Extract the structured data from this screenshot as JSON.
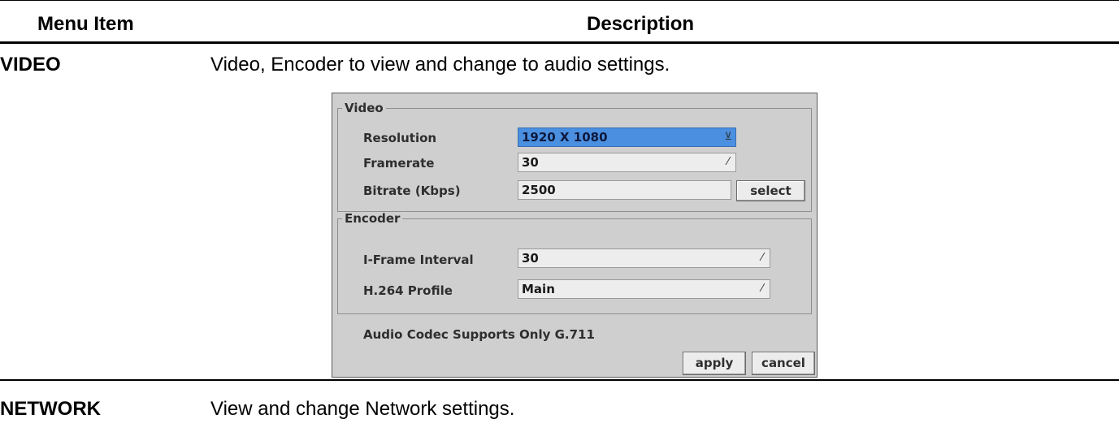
{
  "table": {
    "header_item": "Menu Item",
    "header_desc": "Description",
    "rows": [
      {
        "item": "VIDEO",
        "desc": "Video, Encoder to view and change to audio settings."
      },
      {
        "item": "NETWORK",
        "desc": "View and change Network settings."
      }
    ]
  },
  "dialog": {
    "video": {
      "title": "Video",
      "resolution": {
        "label": "Resolution",
        "value": "1920 X 1080"
      },
      "framerate": {
        "label": "Framerate",
        "value": "30"
      },
      "bitrate": {
        "label": "Bitrate (Kbps)",
        "value": "2500",
        "button": "select"
      }
    },
    "encoder": {
      "title": "Encoder",
      "iframe": {
        "label": "I-Frame Interval",
        "value": "30"
      },
      "profile": {
        "label": "H.264 Profile",
        "value": "Main"
      }
    },
    "audio_note": "Audio Codec Supports Only G.711",
    "apply": "apply",
    "cancel": "cancel"
  },
  "colors": {
    "dialog_bg": "#cfcfcf",
    "selected_field": "#4a8fe0",
    "field_bg": "#ededed"
  },
  "icons": {
    "dropdown": "chevron-down-icon"
  }
}
